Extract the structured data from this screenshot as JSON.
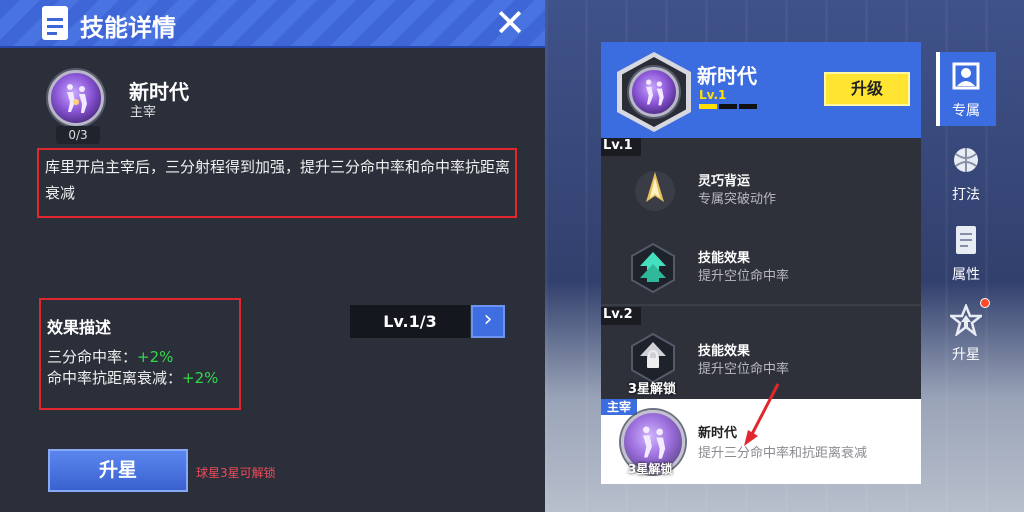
{
  "left_panel": {
    "title": "技能详情",
    "close_icon": "close-icon",
    "skill": {
      "name": "新时代",
      "role": "主宰",
      "count": "0/3",
      "description": "库里开启主宰后，三分射程得到加强，提升三分命中率和命中率抗距离衰减"
    },
    "effect": {
      "title": "效果描述",
      "lines": [
        {
          "label": "三分命中率：",
          "value": "+2%"
        },
        {
          "label": "命中率抗距离衰减：",
          "value": "+2%"
        }
      ],
      "value_color": "#33d94a"
    },
    "level_display": "Lv.1/3",
    "next_icon": "chevron-right-icon",
    "star_up_button": "升星",
    "unlock_hint": "球星3星可解锁"
  },
  "exclusive": {
    "name": "新时代",
    "level": "Lv.1",
    "level_progress": 0.33,
    "upgrade_button": "升级",
    "groups": [
      {
        "level_tag": "Lv.1",
        "items": [
          {
            "title": "灵巧背运",
            "subtitle": "专属突破动作"
          },
          {
            "title": "技能效果",
            "subtitle": "提升空位命中率"
          }
        ]
      },
      {
        "level_tag": "Lv.2",
        "items": [
          {
            "title": "技能效果",
            "subtitle": "提升空位命中率",
            "lock_label": "3星解锁"
          }
        ]
      }
    ],
    "main_row": {
      "tag": "主宰",
      "title": "新时代",
      "subtitle": "提升三分命中率和抗距离衰减",
      "lock_label": "3星解锁"
    }
  },
  "side_tabs": [
    {
      "label": "专属",
      "icon": "exclusive-icon",
      "active": true
    },
    {
      "label": "打法",
      "icon": "playstyle-icon",
      "active": false
    },
    {
      "label": "属性",
      "icon": "attribute-doc-icon",
      "active": false
    },
    {
      "label": "升星",
      "icon": "star-up-icon",
      "active": false
    }
  ],
  "colors": {
    "accent_blue": "#3c6de0",
    "highlight_red": "#e2262e",
    "upgrade_yellow": "#ffe531"
  }
}
